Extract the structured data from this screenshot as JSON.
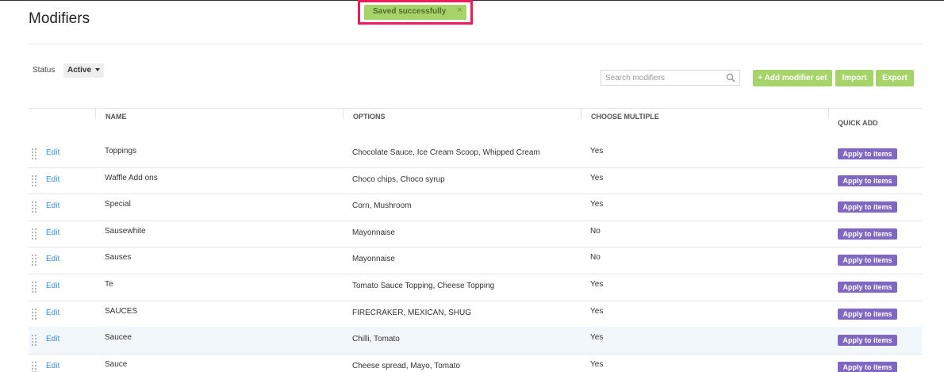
{
  "page": {
    "title": "Modifiers"
  },
  "toast": {
    "message": "Saved successfully",
    "close_glyph": "×",
    "color": "#a6d46a",
    "highlight_border_color": "#ea1e5c"
  },
  "filter": {
    "status_label": "Status",
    "status_value": "Active"
  },
  "search": {
    "placeholder": "Search modifiers",
    "value": "",
    "icon": "search-icon"
  },
  "toolbar": {
    "add_label": "+ Add modifier set",
    "import_label": "Import",
    "export_label": "Export",
    "button_color": "#a6d46a"
  },
  "table": {
    "headers": {
      "name": "NAME",
      "options": "OPTIONS",
      "choose_multiple": "CHOOSE MULTIPLE",
      "quick_add": "QUICK ADD"
    },
    "edit_label": "Edit",
    "apply_label": "Apply to items",
    "apply_color": "#8067c1",
    "rows": [
      {
        "name": "Toppings",
        "options": "Chocolate Sauce, Ice Cream Scoop, Whipped Cream",
        "choose_multiple": "Yes"
      },
      {
        "name": "Waffle Add ons",
        "options": "Choco chips, Choco syrup",
        "choose_multiple": "Yes"
      },
      {
        "name": "Special",
        "options": "Corn, Mushroom",
        "choose_multiple": "Yes"
      },
      {
        "name": "Sausewhite",
        "options": "Mayonnaise",
        "choose_multiple": "No"
      },
      {
        "name": "Sauses",
        "options": "Mayonnaise",
        "choose_multiple": "No"
      },
      {
        "name": "Te",
        "options": "Tomato Sauce Topping, Cheese Topping",
        "choose_multiple": "Yes"
      },
      {
        "name": "SAUCES",
        "options": "FIRECRAKER, MEXICAN, SHUG",
        "choose_multiple": "Yes"
      },
      {
        "name": "Saucee",
        "options": "Chilli, Tomato",
        "choose_multiple": "Yes"
      },
      {
        "name": "Sauce",
        "options": "Cheese spread, Mayo, Tomato",
        "choose_multiple": "Yes"
      }
    ]
  }
}
